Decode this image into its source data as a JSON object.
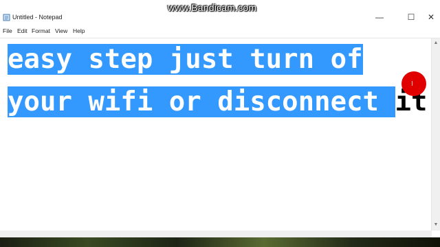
{
  "window": {
    "title": "Untitled - Notepad",
    "watermark": "www.Bandicam.com",
    "controls": {
      "minimize": "—",
      "maximize": "☐",
      "close": "✕"
    }
  },
  "menubar": {
    "items": [
      "File",
      "Edit",
      "Format",
      "View",
      "Help"
    ]
  },
  "editor": {
    "line1_selected": "easy step just turn of",
    "line2_selected": "your wifi or disconnect ",
    "line2_unselected": "it"
  },
  "colors": {
    "selection": "#3399ff",
    "cursor_marker": "#e00000"
  }
}
